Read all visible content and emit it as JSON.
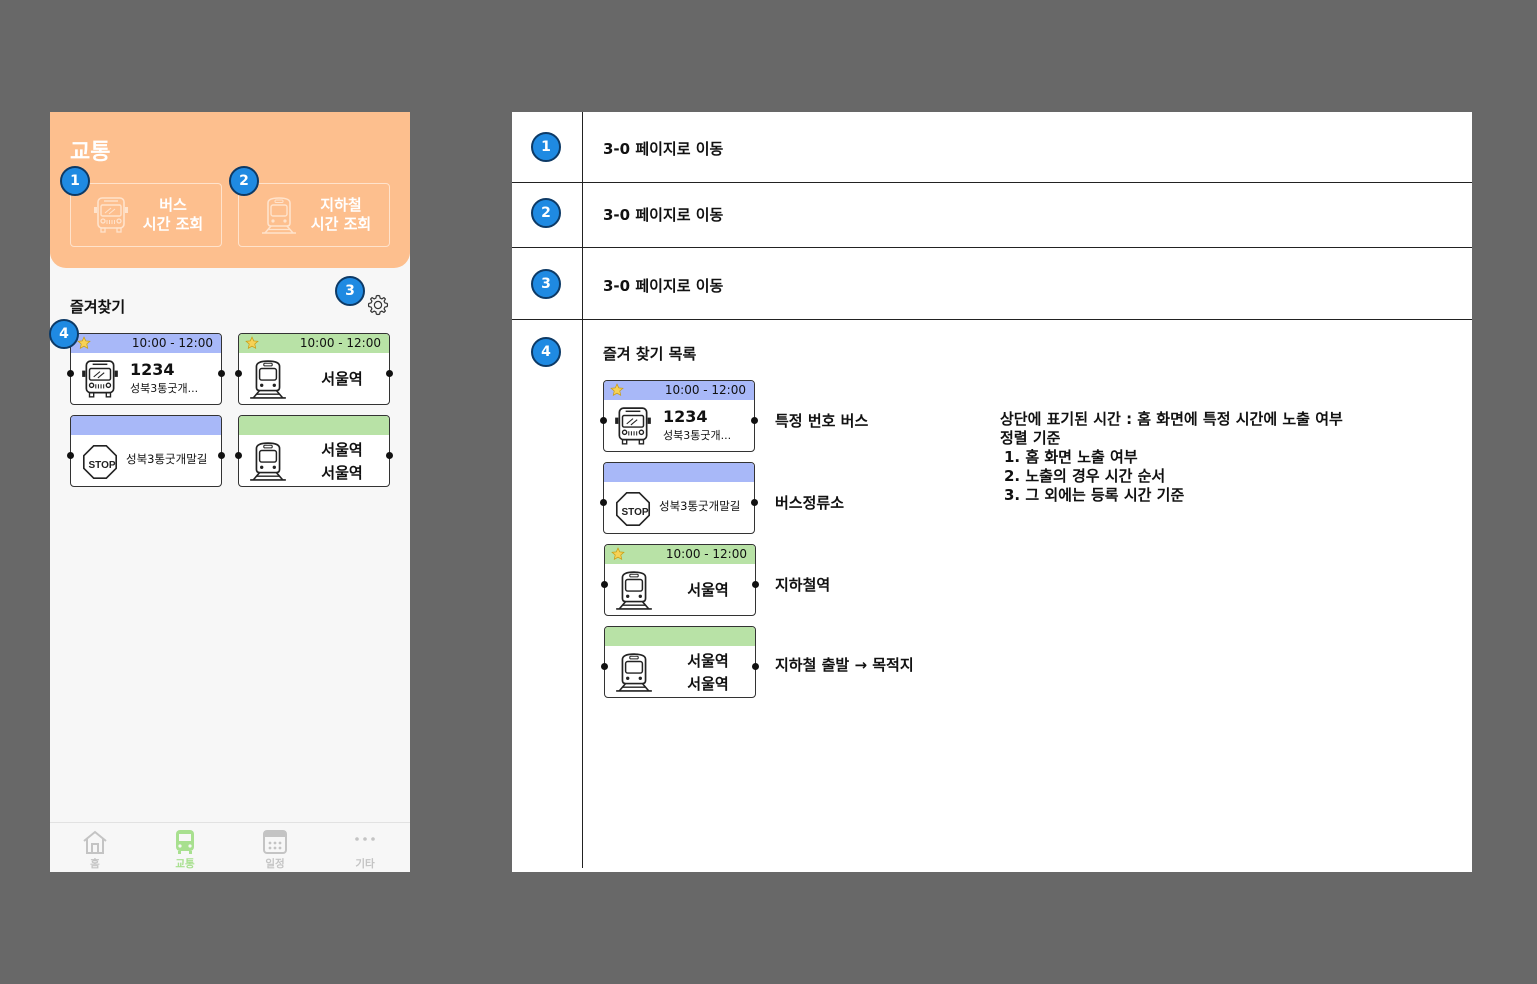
{
  "app": {
    "title": "교통",
    "quick_buttons": [
      {
        "label": "버스\n시간 조회",
        "icon": "bus-icon"
      },
      {
        "label": "지하철\n시간 조회",
        "icon": "subway-icon"
      }
    ],
    "favorites_title": "즐겨찾기",
    "cards": {
      "bus": {
        "time": "10:00 - 12:00",
        "number": "1234",
        "stop": "성북3통굿개..."
      },
      "subway": {
        "time": "10:00 - 12:00",
        "station": "서울역"
      },
      "bus_stop": {
        "name": "성북3통굿개말길",
        "stop_sign": "STOP"
      },
      "route": {
        "from": "서울역",
        "to": "서울역"
      }
    },
    "tabs": [
      {
        "label": "홈",
        "icon": "home-icon"
      },
      {
        "label": "교통",
        "icon": "bus-icon"
      },
      {
        "label": "일정",
        "icon": "calendar-icon"
      },
      {
        "label": "기타",
        "icon": "more-icon"
      }
    ]
  },
  "badges": [
    "1",
    "2",
    "3",
    "4"
  ],
  "spec": {
    "rows": [
      {
        "num": "1",
        "text": "3-0 페이지로 이동"
      },
      {
        "num": "2",
        "text": "3-0 페이지로 이동"
      },
      {
        "num": "3",
        "text": "3-0 페이지로 이동"
      },
      {
        "num": "4",
        "text": "즐겨 찾기 목록"
      }
    ],
    "item_descriptions": [
      "특정 번호 버스",
      "버스정류소",
      "지하철역",
      "지하철 출발 → 목적지"
    ],
    "note": {
      "line1": "상단에 표기된 시간 : 홈 화면에 특정 시간에 노출 여부",
      "line2": "정렬 기준",
      "items": [
        "1. 홈 화면 노출 여부",
        "2. 노출의 경우 시간 순서",
        "3. 그 외에는 등록 시간 기준"
      ]
    }
  },
  "colors": {
    "header": "#fdbf8e",
    "bus_bar": "#a8b8f8",
    "subway_bar": "#b8e2a6",
    "badge": "#1f8ae2",
    "active_tab": "#a8e08f"
  }
}
